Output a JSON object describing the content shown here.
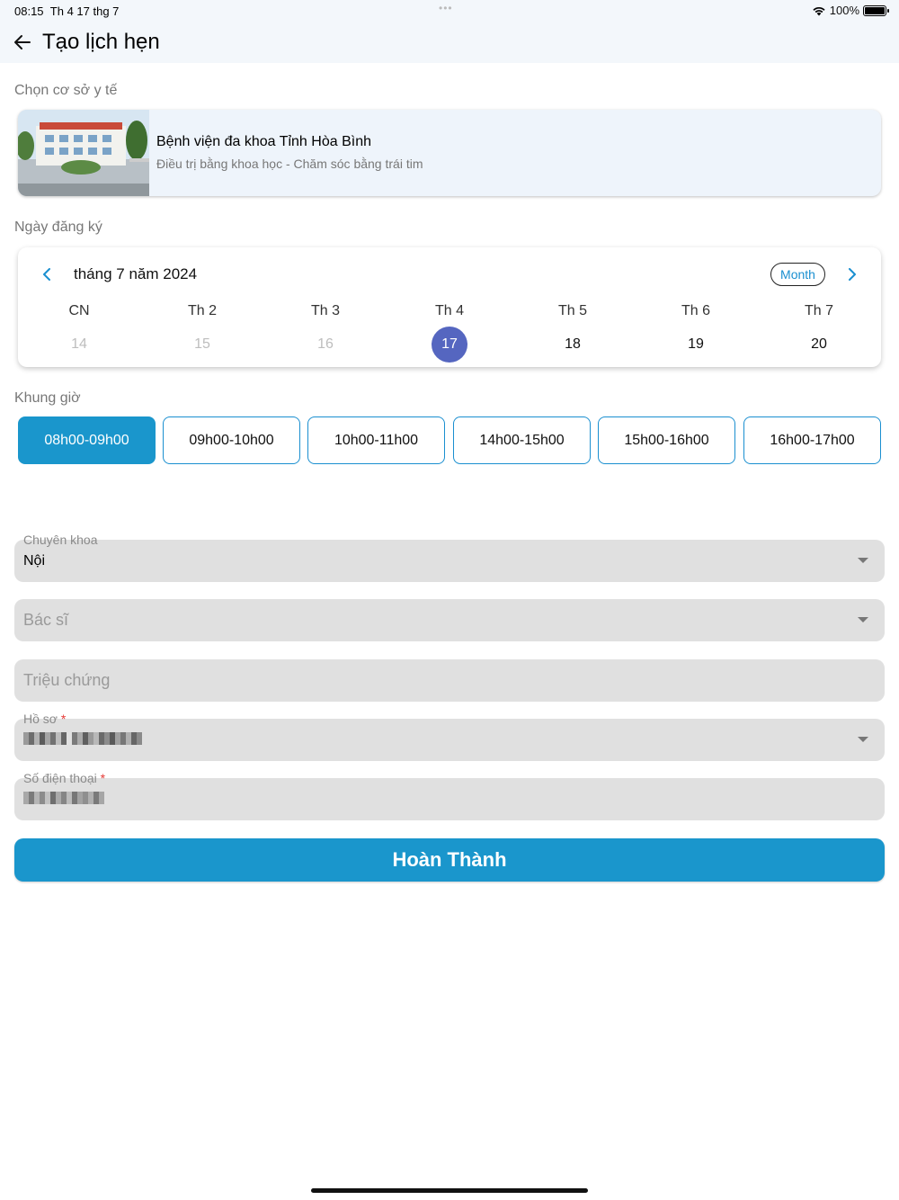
{
  "status_bar": {
    "time": "08:15",
    "date": "Th 4 17 thg 7",
    "battery": "100%"
  },
  "header": {
    "title": "Tạo lịch hẹn",
    "back_icon": "arrow-left-icon"
  },
  "facility": {
    "section_label": "Chọn cơ sở y tế",
    "name": "Bệnh viện đa khoa Tỉnh Hòa Bình",
    "slogan": "Điều trị bằng khoa học - Chăm sóc bằng trái tim"
  },
  "date_section": {
    "section_label": "Ngày đăng ký",
    "month_title": "tháng 7 năm 2024",
    "view_mode": "Month",
    "days": [
      {
        "name": "CN",
        "num": "14",
        "state": "past"
      },
      {
        "name": "Th 2",
        "num": "15",
        "state": "past"
      },
      {
        "name": "Th 3",
        "num": "16",
        "state": "past"
      },
      {
        "name": "Th 4",
        "num": "17",
        "state": "selected"
      },
      {
        "name": "Th 5",
        "num": "18",
        "state": "future"
      },
      {
        "name": "Th 6",
        "num": "19",
        "state": "future"
      },
      {
        "name": "Th 7",
        "num": "20",
        "state": "future"
      }
    ]
  },
  "time_section": {
    "section_label": "Khung giờ",
    "slots": [
      "08h00-09h00",
      "09h00-10h00",
      "10h00-11h00",
      "14h00-15h00",
      "15h00-16h00",
      "16h00-17h00"
    ],
    "selected": "08h00-09h00"
  },
  "form": {
    "specialty": {
      "label": "Chuyên khoa",
      "value": "Nội"
    },
    "doctor": {
      "placeholder": "Bác sĩ"
    },
    "symptoms": {
      "placeholder": "Triệu chứng"
    },
    "profile": {
      "label": "Hồ sơ",
      "required_mark": "*"
    },
    "phone": {
      "label": "Số điện thoại",
      "required_mark": "*"
    }
  },
  "submit": {
    "label": "Hoàn Thành"
  },
  "colors": {
    "accent": "#1a96cc",
    "selected_date": "#5566c0",
    "field_bg": "#e0e0e0",
    "required": "#e53935"
  }
}
